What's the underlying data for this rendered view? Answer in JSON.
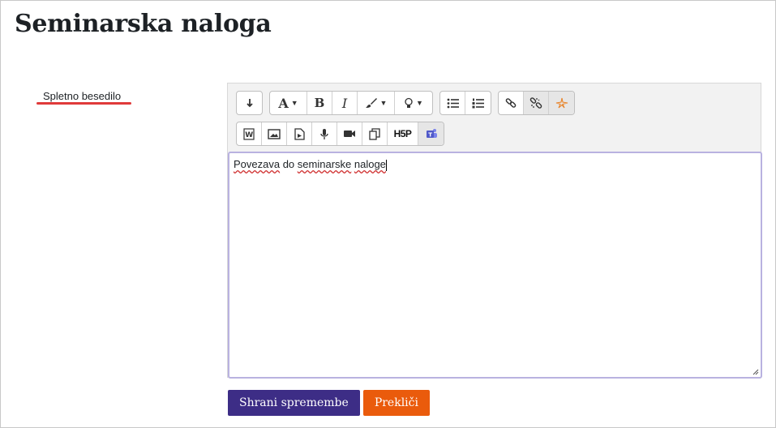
{
  "page": {
    "title": "Seminarska naloga"
  },
  "field": {
    "label": "Spletno besedilo"
  },
  "editor": {
    "content_parts": [
      "Povezava",
      " do ",
      "seminarske",
      " ",
      "naloge"
    ],
    "toolbar_row1": [
      [
        "collapse-icon"
      ],
      [
        "font-style-icon",
        "bold-icon",
        "italic-icon",
        "brush-color-icon",
        "lightbulb-icon"
      ],
      [
        "unordered-list-icon",
        "ordered-list-icon"
      ],
      [
        "link-icon",
        "unlink-icon",
        "starburst-icon"
      ]
    ],
    "toolbar_row2": [
      [
        "word-import-icon",
        "image-icon",
        "media-file-icon",
        "microphone-icon",
        "video-camera-icon",
        "copy-icon",
        "h5p-icon",
        "teams-icon"
      ]
    ],
    "h5p_label": "H5P",
    "bold_label": "B",
    "italic_label": "I",
    "font_label": "A"
  },
  "actions": {
    "save_label": "Shrani spremembe",
    "cancel_label": "Prekliči"
  },
  "colors": {
    "primary": "#3d2d86",
    "cancel": "#ea5b0c",
    "underline_red": "#e03a3a",
    "focus_border": "#b9b2e0"
  }
}
